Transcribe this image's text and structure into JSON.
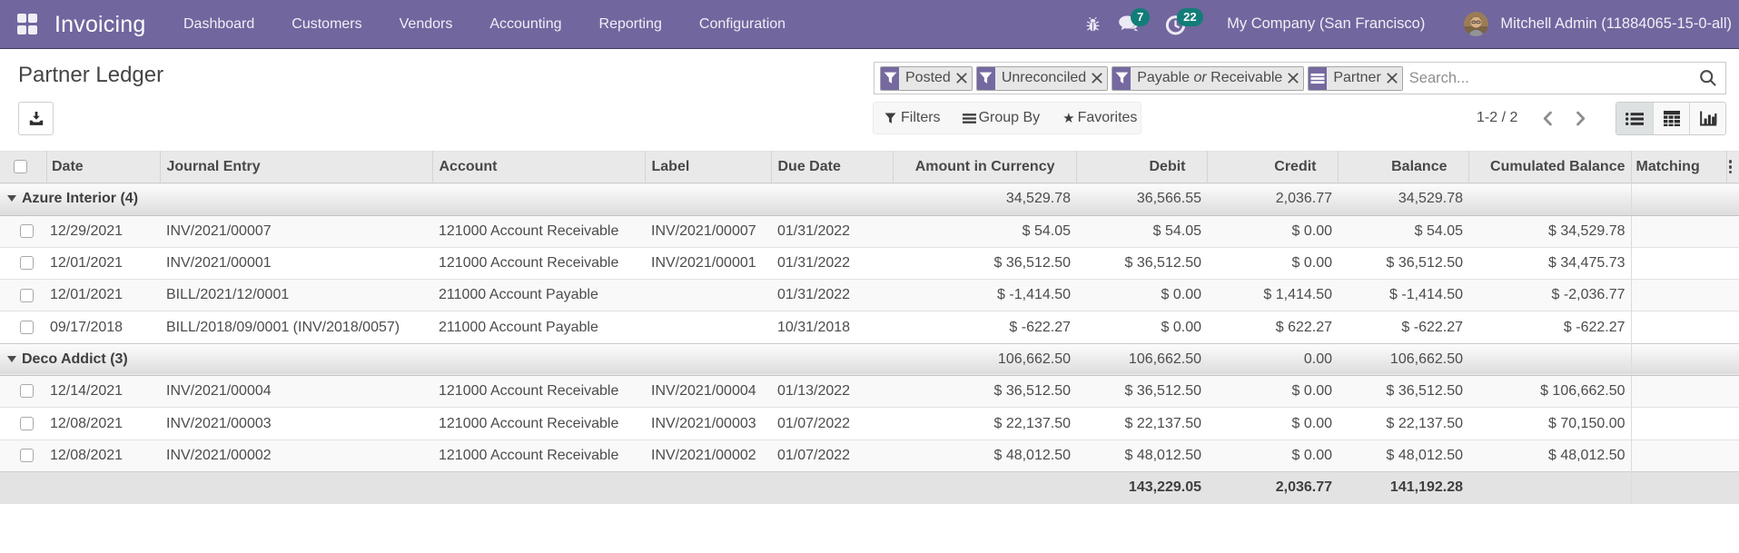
{
  "nav": {
    "app_name": "Invoicing",
    "menu_items": [
      "Dashboard",
      "Customers",
      "Vendors",
      "Accounting",
      "Reporting",
      "Configuration"
    ],
    "systray": {
      "messages_count": "7",
      "activities_count": "22",
      "company": "My Company (San Francisco)",
      "user": "Mitchell Admin (11884065-15-0-all)"
    }
  },
  "control_panel": {
    "title": "Partner Ledger",
    "search": {
      "placeholder": "Search...",
      "facets": [
        {
          "icon": "filter-icon",
          "label": "Posted"
        },
        {
          "icon": "filter-icon",
          "label": "Unreconciled"
        },
        {
          "icon": "filter-icon",
          "label": "Payable or Receivable",
          "parts": {
            "pre": "Payable ",
            "italic": "or",
            "post": " Receivable"
          }
        },
        {
          "icon": "group-by-icon",
          "label": "Partner"
        }
      ]
    },
    "buttons": {
      "filters": "Filters",
      "group_by": "Group By",
      "favorites": "Favorites"
    },
    "pager": {
      "text": "1-2 / 2"
    },
    "view_switcher": [
      {
        "name": "list",
        "active": true
      },
      {
        "name": "pivot",
        "active": false
      },
      {
        "name": "graph",
        "active": false
      }
    ]
  },
  "accent_colors": {
    "navbar": "#71669e",
    "badge": "#127d78",
    "facet_icon_bg": "#7569a0"
  },
  "table": {
    "columns": [
      {
        "key": "select",
        "label": "",
        "type": "checkbox",
        "align": "left"
      },
      {
        "key": "date",
        "label": "Date",
        "align": "left"
      },
      {
        "key": "journal_entry",
        "label": "Journal Entry",
        "align": "left"
      },
      {
        "key": "account",
        "label": "Account",
        "align": "left"
      },
      {
        "key": "label",
        "label": "Label",
        "align": "left"
      },
      {
        "key": "due_date",
        "label": "Due Date",
        "align": "left"
      },
      {
        "key": "amount_currency",
        "label": "Amount in Currency",
        "align": "right"
      },
      {
        "key": "debit",
        "label": "Debit",
        "align": "right"
      },
      {
        "key": "credit",
        "label": "Credit",
        "align": "right"
      },
      {
        "key": "balance",
        "label": "Balance",
        "align": "right"
      },
      {
        "key": "cumulated_balance",
        "label": "Cumulated Balance",
        "align": "right-tight"
      },
      {
        "key": "matching",
        "label": "Matching",
        "align": "left"
      },
      {
        "key": "toggle",
        "label": "",
        "type": "dots",
        "align": "left"
      }
    ],
    "groups": [
      {
        "label": "Azure Interior (4)",
        "aggregates": {
          "amount_currency": "34,529.78",
          "debit": "36,566.55",
          "credit": "2,036.77",
          "balance": "34,529.78"
        },
        "rows": [
          {
            "date": "12/29/2021",
            "journal_entry": "INV/2021/00007",
            "account": "121000 Account Receivable",
            "label": "INV/2021/00007",
            "due_date": "01/31/2022",
            "amount_currency": "$ 54.05",
            "debit": "$ 54.05",
            "credit": "$ 0.00",
            "balance": "$ 54.05",
            "cumulated_balance": "$ 34,529.78",
            "matching": ""
          },
          {
            "date": "12/01/2021",
            "journal_entry": "INV/2021/00001",
            "account": "121000 Account Receivable",
            "label": "INV/2021/00001",
            "due_date": "01/31/2022",
            "amount_currency": "$ 36,512.50",
            "debit": "$ 36,512.50",
            "credit": "$ 0.00",
            "balance": "$ 36,512.50",
            "cumulated_balance": "$ 34,475.73",
            "matching": ""
          },
          {
            "date": "12/01/2021",
            "journal_entry": "BILL/2021/12/0001",
            "account": "211000 Account Payable",
            "label": "",
            "due_date": "01/31/2022",
            "amount_currency": "$ -1,414.50",
            "debit": "$ 0.00",
            "credit": "$ 1,414.50",
            "balance": "$ -1,414.50",
            "cumulated_balance": "$ -2,036.77",
            "matching": ""
          },
          {
            "date": "09/17/2018",
            "journal_entry": "BILL/2018/09/0001 (INV/2018/0057)",
            "account": "211000 Account Payable",
            "label": "",
            "due_date": "10/31/2018",
            "amount_currency": "$ -622.27",
            "debit": "$ 0.00",
            "credit": "$ 622.27",
            "balance": "$ -622.27",
            "cumulated_balance": "$ -622.27",
            "matching": ""
          }
        ]
      },
      {
        "label": "Deco Addict (3)",
        "aggregates": {
          "amount_currency": "106,662.50",
          "debit": "106,662.50",
          "credit": "0.00",
          "balance": "106,662.50"
        },
        "rows": [
          {
            "date": "12/14/2021",
            "journal_entry": "INV/2021/00004",
            "account": "121000 Account Receivable",
            "label": "INV/2021/00004",
            "due_date": "01/13/2022",
            "amount_currency": "$ 36,512.50",
            "debit": "$ 36,512.50",
            "credit": "$ 0.00",
            "balance": "$ 36,512.50",
            "cumulated_balance": "$ 106,662.50",
            "matching": ""
          },
          {
            "date": "12/08/2021",
            "journal_entry": "INV/2021/00003",
            "account": "121000 Account Receivable",
            "label": "INV/2021/00003",
            "due_date": "01/07/2022",
            "amount_currency": "$ 22,137.50",
            "debit": "$ 22,137.50",
            "credit": "$ 0.00",
            "balance": "$ 22,137.50",
            "cumulated_balance": "$ 70,150.00",
            "matching": ""
          },
          {
            "date": "12/08/2021",
            "journal_entry": "INV/2021/00002",
            "account": "121000 Account Receivable",
            "label": "INV/2021/00002",
            "due_date": "01/07/2022",
            "amount_currency": "$ 48,012.50",
            "debit": "$ 48,012.50",
            "credit": "$ 0.00",
            "balance": "$ 48,012.50",
            "cumulated_balance": "$ 48,012.50",
            "matching": ""
          }
        ]
      }
    ],
    "footer": {
      "debit": "143,229.05",
      "credit": "2,036.77",
      "balance": "141,192.28"
    }
  }
}
